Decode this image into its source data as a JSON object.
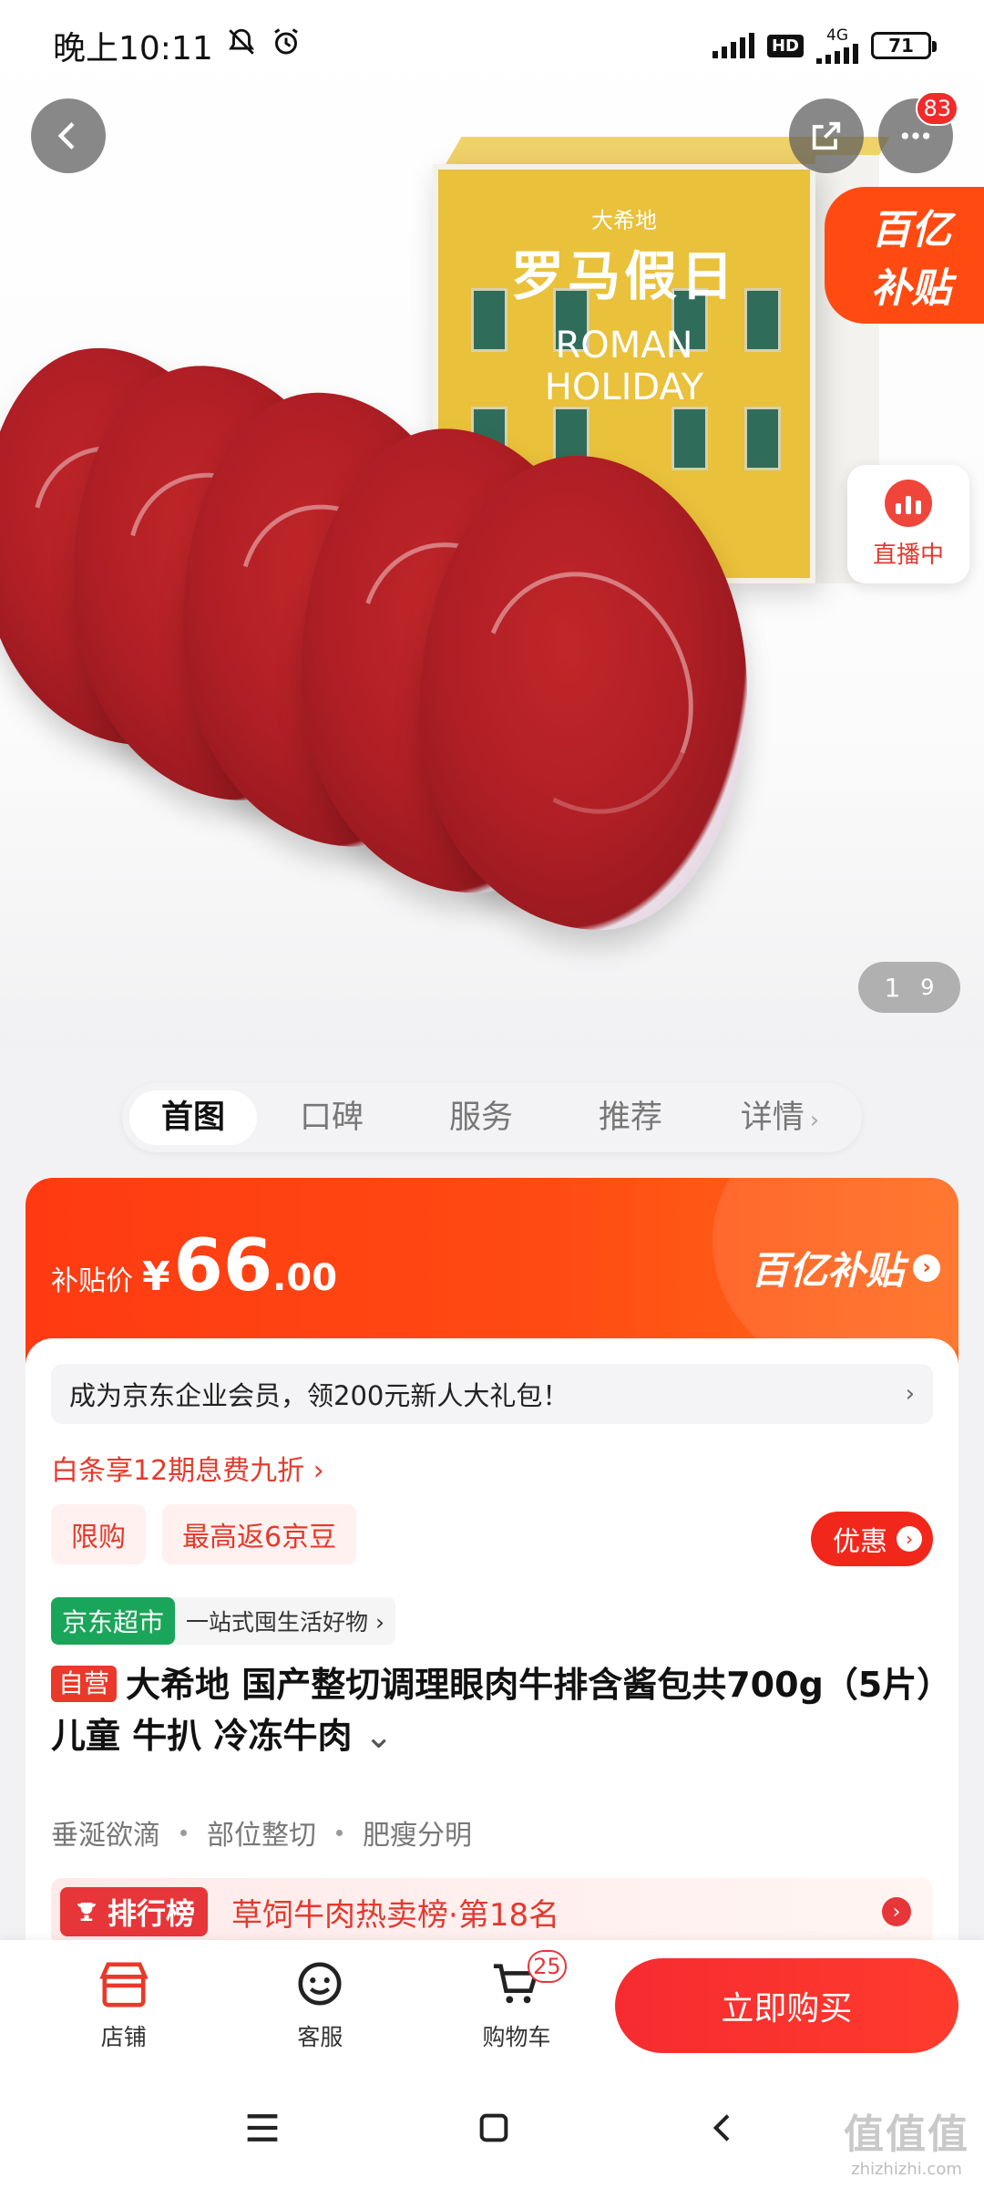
{
  "status": {
    "time": "晚上10:11",
    "network": "4G",
    "hd": "HD",
    "battery": "71"
  },
  "hero": {
    "image_desc": "steak-product-photo",
    "box_brand": "大希地",
    "box_title": "罗马假日",
    "box_sub_1": "ROMAN",
    "box_sub_2": "HOLIDAY",
    "subsidy_flag_1": "百亿",
    "subsidy_flag_2": "补贴",
    "live_label": "直播中",
    "pager_current": "1",
    "pager_total": "9",
    "more_badge": "83"
  },
  "anchor_tabs": [
    "首图",
    "口碑",
    "服务",
    "推荐",
    "详情"
  ],
  "price": {
    "label": "补贴价",
    "symbol": "¥",
    "integer": "66",
    "decimal": ".00",
    "brand_tag": "百亿补贴"
  },
  "member_bar": "成为京东企业会员，领200元新人大礼包！",
  "baitiao": "白条享12期息费九折 ›",
  "chips": [
    "限购",
    "最高返6京豆"
  ],
  "offer_button": "优惠",
  "market": {
    "tag": "京东超市",
    "text": "一站式囤生活好物 ›"
  },
  "product": {
    "self_tag": "自营",
    "title": "大希地 国产整切调理眼肉牛排含酱包共700g（5片）儿童 牛扒 冷冻牛肉"
  },
  "features": [
    "垂涎欲滴",
    "部位整切",
    "肥瘦分明"
  ],
  "rank": {
    "tag": "排行榜",
    "text": "草饲牛肉热卖榜·第18名"
  },
  "bottom_bar": {
    "shop": "店铺",
    "service": "客服",
    "cart": "购物车",
    "cart_count": "25",
    "buy": "立即购买"
  },
  "watermark": {
    "logo": "值值值",
    "url": "zhizhizhi.com"
  }
}
